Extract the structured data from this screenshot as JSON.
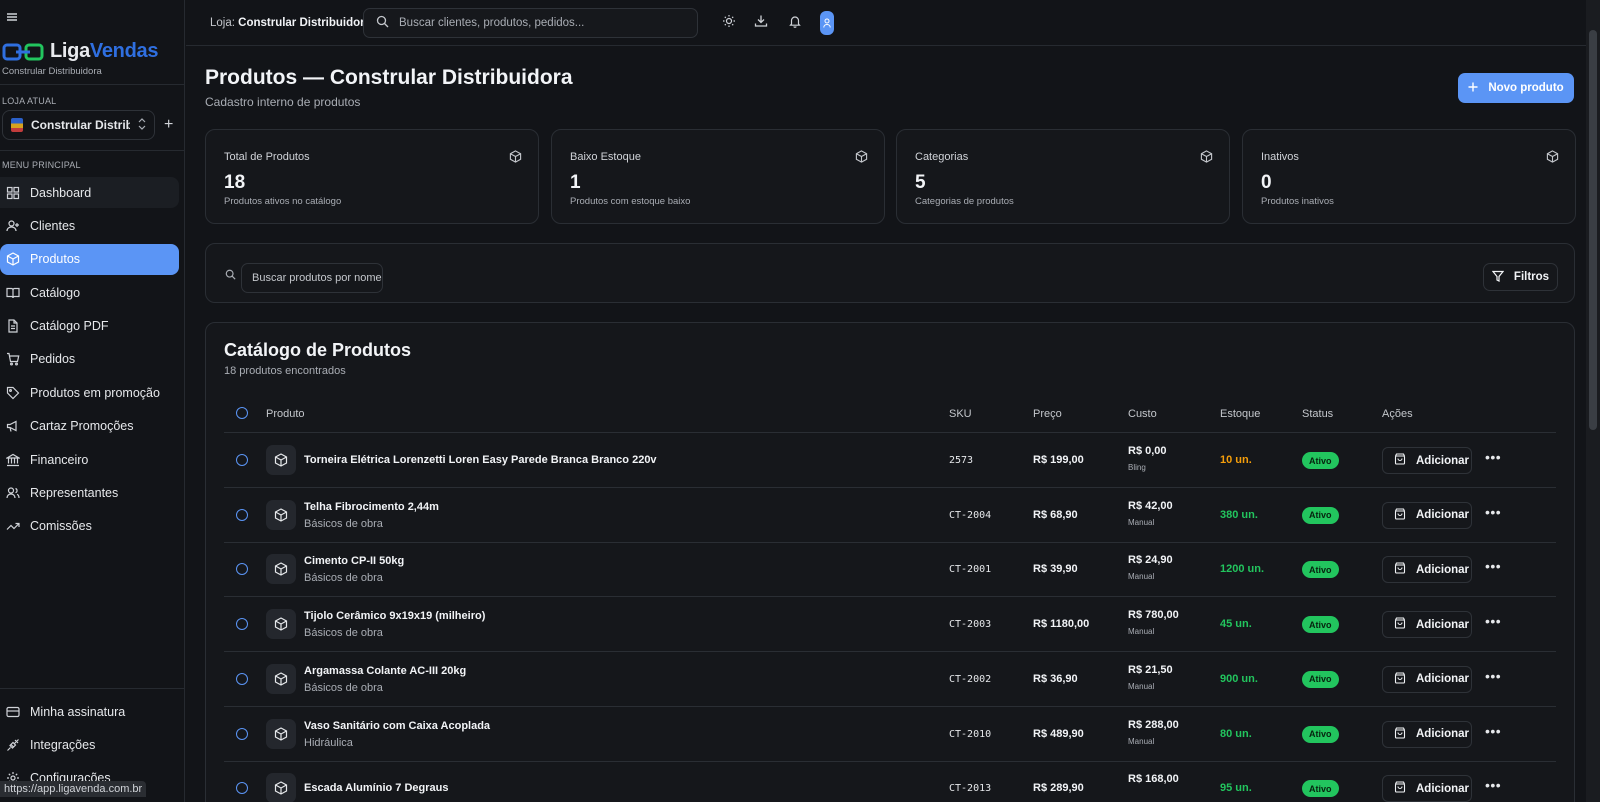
{
  "colors": {
    "accent": "#5b95f5",
    "active_badge": "#22c55e",
    "stock_low": "#f59e0b",
    "stock_ok": "#22c55e",
    "logo_blue": "#2f6fe0"
  },
  "sidebar": {
    "brand_a": "Liga",
    "brand_b": "Vendas",
    "brand_sub": "Constrular Distribuidora",
    "store_section": "LOJA ATUAL",
    "store_name": "Constrular Distrib...",
    "menu_section": "MENU PRINCIPAL",
    "items": [
      {
        "label": "Dashboard",
        "icon": "grid-icon"
      },
      {
        "label": "Clientes",
        "icon": "user-plus-icon"
      },
      {
        "label": "Produtos",
        "icon": "box-icon"
      },
      {
        "label": "Catálogo",
        "icon": "book-icon"
      },
      {
        "label": "Catálogo PDF",
        "icon": "file-icon"
      },
      {
        "label": "Pedidos",
        "icon": "cart-icon"
      },
      {
        "label": "Produtos em promoção",
        "icon": "tag-icon"
      },
      {
        "label": "Cartaz Promoções",
        "icon": "megaphone-icon"
      },
      {
        "label": "Financeiro",
        "icon": "bank-icon"
      },
      {
        "label": "Representantes",
        "icon": "users-icon"
      },
      {
        "label": "Comissões",
        "icon": "trend-icon"
      }
    ],
    "bottom_items": [
      {
        "label": "Minha assinatura",
        "icon": "card-icon"
      },
      {
        "label": "Integrações",
        "icon": "plug-icon"
      },
      {
        "label": "Configurações",
        "icon": "gear-icon"
      }
    ],
    "status_url": "https://app.ligavenda.com.br"
  },
  "topbar": {
    "store_prefix": "Loja:",
    "store_name": "Constrular Distribuidora",
    "search_placeholder": "Buscar clientes, produtos, pedidos..."
  },
  "page": {
    "title": "Produtos — Constrular Distribuidora",
    "subtitle": "Cadastro interno de produtos",
    "new_button": "Novo produto"
  },
  "stats": [
    {
      "label": "Total de Produtos",
      "value": "18",
      "desc": "Produtos ativos no catálogo"
    },
    {
      "label": "Baixo Estoque",
      "value": "1",
      "desc": "Produtos com estoque baixo"
    },
    {
      "label": "Categorias",
      "value": "5",
      "desc": "Categorias de produtos"
    },
    {
      "label": "Inativos",
      "value": "0",
      "desc": "Produtos inativos"
    }
  ],
  "filters": {
    "search_placeholder": "Buscar produtos por nome",
    "filter_button": "Filtros"
  },
  "catalog": {
    "title": "Catálogo de Produtos",
    "subtitle": "18 produtos encontrados",
    "columns": [
      "Produto",
      "SKU",
      "Preço",
      "Custo",
      "Estoque",
      "Status",
      "Ações"
    ],
    "add_label": "Adicionar",
    "rows": [
      {
        "name": "Torneira Elétrica Lorenzetti Loren Easy Parede Branca Branco 220v",
        "category": "",
        "sku": "2573",
        "price": "R$ 199,00",
        "cost": "R$ 0,00",
        "cost_src": "Bling",
        "stock": "10 un.",
        "stock_low": true,
        "status": "Ativo"
      },
      {
        "name": "Telha Fibrocimento 2,44m",
        "category": "Básicos de obra",
        "sku": "CT-2004",
        "price": "R$ 68,90",
        "cost": "R$ 42,00",
        "cost_src": "Manual",
        "stock": "380 un.",
        "stock_low": false,
        "status": "Ativo"
      },
      {
        "name": "Cimento CP-II 50kg",
        "category": "Básicos de obra",
        "sku": "CT-2001",
        "price": "R$ 39,90",
        "cost": "R$ 24,90",
        "cost_src": "Manual",
        "stock": "1200 un.",
        "stock_low": false,
        "status": "Ativo"
      },
      {
        "name": "Tijolo Cerâmico 9x19x19 (milheiro)",
        "category": "Básicos de obra",
        "sku": "CT-2003",
        "price": "R$ 1180,00",
        "cost": "R$ 780,00",
        "cost_src": "Manual",
        "stock": "45 un.",
        "stock_low": false,
        "status": "Ativo"
      },
      {
        "name": "Argamassa Colante AC-III 20kg",
        "category": "Básicos de obra",
        "sku": "CT-2002",
        "price": "R$ 36,90",
        "cost": "R$ 21,50",
        "cost_src": "Manual",
        "stock": "900 un.",
        "stock_low": false,
        "status": "Ativo"
      },
      {
        "name": "Vaso Sanitário com Caixa Acoplada",
        "category": "Hidráulica",
        "sku": "CT-2010",
        "price": "R$ 489,90",
        "cost": "R$ 288,00",
        "cost_src": "Manual",
        "stock": "80 un.",
        "stock_low": false,
        "status": "Ativo"
      },
      {
        "name": "Escada Alumínio 7 Degraus",
        "category": "",
        "sku": "CT-2013",
        "price": "R$ 289,90",
        "cost": "R$ 168,00",
        "cost_src": "",
        "stock": "95 un.",
        "stock_low": false,
        "status": "Ativo"
      }
    ]
  }
}
